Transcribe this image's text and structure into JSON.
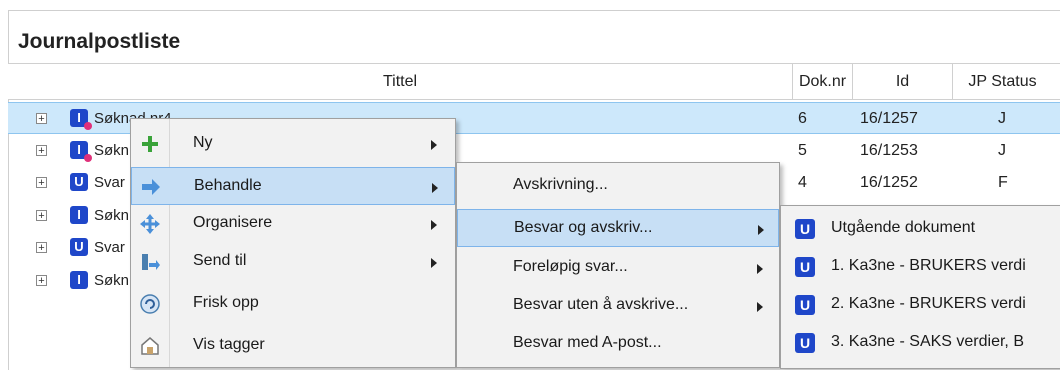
{
  "panel": {
    "title": "Journalpostliste"
  },
  "columns": [
    {
      "key": "tittel",
      "label": "Tittel"
    },
    {
      "key": "doknr",
      "label": "Dok.nr"
    },
    {
      "key": "id",
      "label": "Id"
    },
    {
      "key": "status",
      "label": "JP Status"
    }
  ],
  "rows": [
    {
      "icon": "I",
      "badge": true,
      "title": "Søknad nr4",
      "doknr": "6",
      "id": "16/1257",
      "status": "J",
      "selected": true
    },
    {
      "icon": "I",
      "badge": true,
      "title": "Søkn",
      "doknr": "5",
      "id": "16/1253",
      "status": "J"
    },
    {
      "icon": "U",
      "title": "Svar",
      "doknr": "4",
      "id": "16/1252",
      "status": "F"
    },
    {
      "icon": "I",
      "title": "Søkn"
    },
    {
      "icon": "U",
      "title": "Svar"
    },
    {
      "icon": "I",
      "title": "Søkn"
    }
  ],
  "context_menu": {
    "items": [
      {
        "label": "Ny",
        "icon": "plus-icon",
        "submenu": true
      },
      {
        "label": "Behandle",
        "icon": "arrow-right-icon",
        "submenu": true,
        "active": true
      },
      {
        "label": "Organisere",
        "icon": "move-icon",
        "submenu": true
      },
      {
        "label": "Send til",
        "icon": "send-icon",
        "submenu": true
      },
      {
        "label": "Frisk opp",
        "icon": "refresh-icon"
      },
      {
        "label": "Vis tagger",
        "icon": "tag-icon"
      }
    ]
  },
  "behandle_menu": {
    "items": [
      {
        "label": "Avskrivning..."
      },
      {
        "label": "Besvar og avskriv...",
        "submenu": true,
        "active": true
      },
      {
        "label": "Foreløpig svar...",
        "submenu": true
      },
      {
        "label": "Besvar uten å avskrive...",
        "submenu": true
      },
      {
        "label": "Besvar med A-post..."
      }
    ]
  },
  "besvar_menu": {
    "items": [
      {
        "label": "Utgående dokument"
      },
      {
        "label": "1. Ka3ne - BRUKERS verdi"
      },
      {
        "label": "2. Ka3ne - BRUKERS verdi"
      },
      {
        "label": "3. Ka3ne - SAKS verdier, B"
      }
    ]
  },
  "colors": {
    "selection": "#cde8fb",
    "menu_highlight": "#c7dff5",
    "icon_blue": "#1f47c9"
  }
}
